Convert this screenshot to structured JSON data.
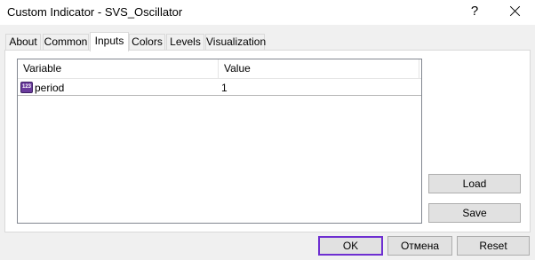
{
  "window": {
    "title": "Custom Indicator - SVS_Oscillator",
    "help_glyph": "?",
    "close_icon": "close-icon"
  },
  "tabs": [
    {
      "label": "About",
      "active": false
    },
    {
      "label": "Common",
      "active": false
    },
    {
      "label": "Inputs",
      "active": true
    },
    {
      "label": "Colors",
      "active": false
    },
    {
      "label": "Levels",
      "active": false
    },
    {
      "label": "Visualization",
      "active": false
    }
  ],
  "inputs_table": {
    "columns": [
      "Variable",
      "Value"
    ],
    "rows": [
      {
        "icon": "integer-type-icon",
        "icon_text": "123",
        "variable": "period",
        "value": "1"
      }
    ]
  },
  "side_buttons": {
    "load": "Load",
    "save": "Save"
  },
  "footer_buttons": {
    "ok": "OK",
    "cancel": "Отмена",
    "reset": "Reset"
  },
  "colors": {
    "accent_focus": "#6e2fd1",
    "type_icon": "#6a3b9c"
  }
}
